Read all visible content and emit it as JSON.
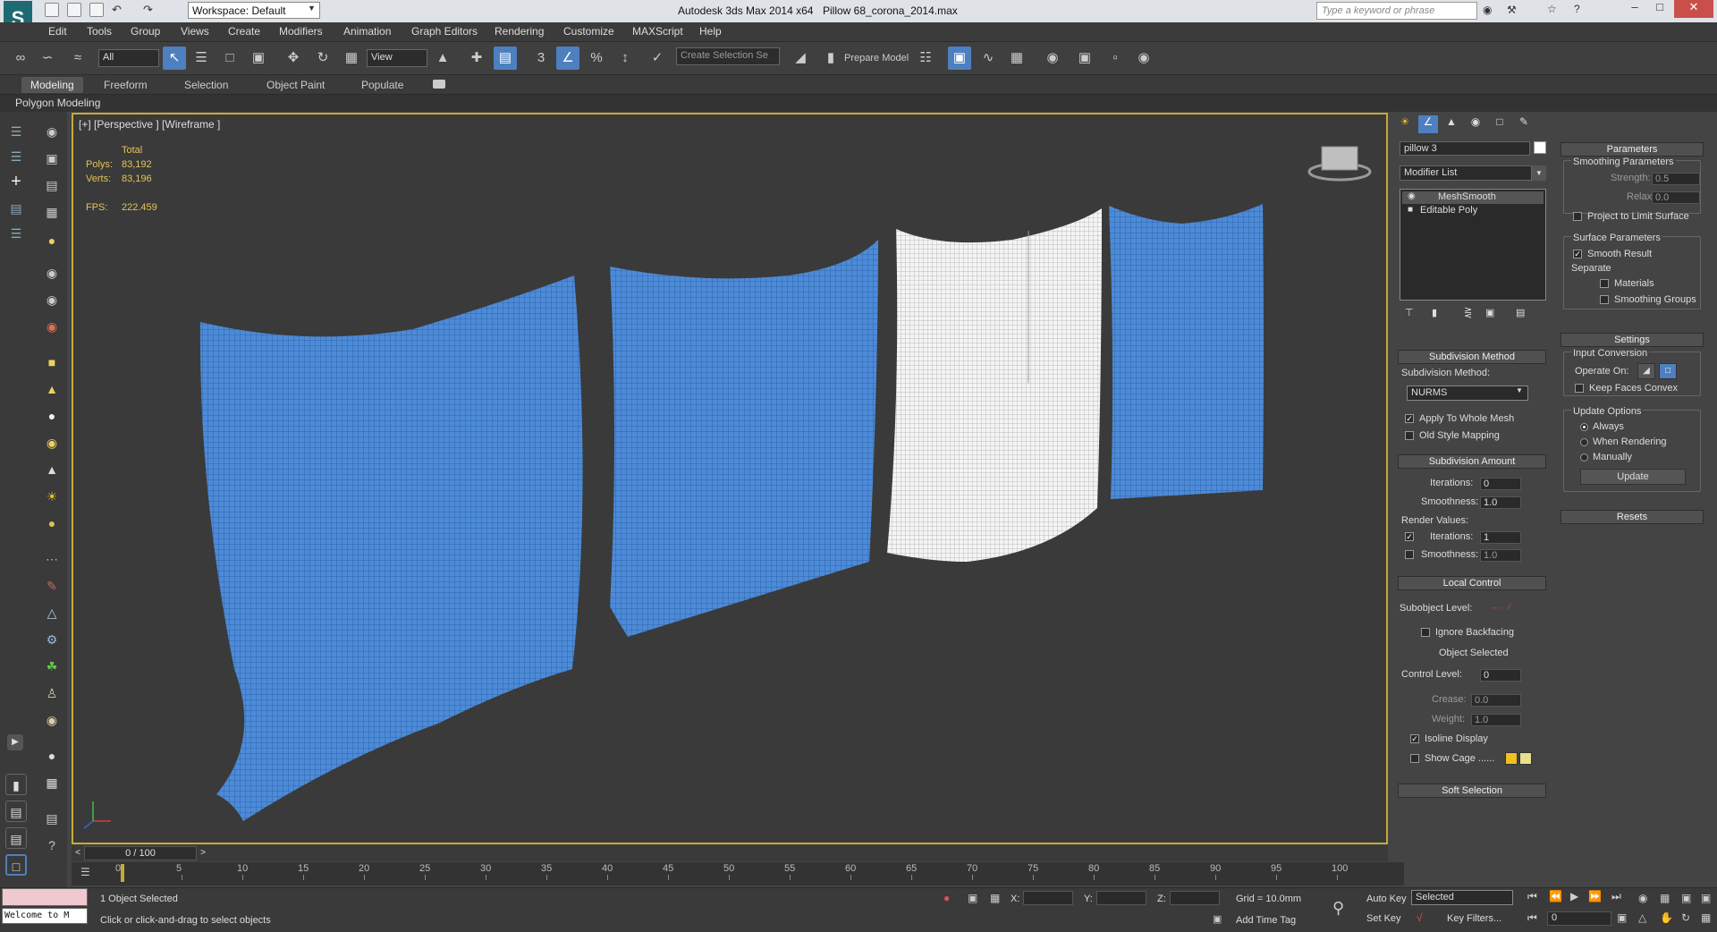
{
  "titlebar": {
    "app_title": "Autodesk 3ds Max  2014 x64",
    "file_title": "Pillow 68_corona_2014.max",
    "workspace": "Workspace: Default",
    "search_placeholder": "Type a keyword or phrase"
  },
  "menu": [
    "Edit",
    "Tools",
    "Group",
    "Views",
    "Create",
    "Modifiers",
    "Animation",
    "Graph Editors",
    "Rendering",
    "Customize",
    "MAXScript",
    "Help"
  ],
  "toolbar": {
    "selection_filter": "All",
    "ref_coord": "View",
    "named_selection": "Create Selection Se",
    "prepare_model": "Prepare Model"
  },
  "ribbon": {
    "tabs": [
      "Modeling",
      "Freeform",
      "Selection",
      "Object Paint",
      "Populate"
    ],
    "active_tab": "Modeling",
    "panel_label": "Polygon Modeling"
  },
  "viewport": {
    "label": "[+] [Perspective ] [Wireframe ]",
    "stats": {
      "total_label": "Total",
      "polys_label": "Polys:",
      "polys_value": "83,192",
      "verts_label": "Verts:",
      "verts_value": "83,196",
      "fps_label": "FPS:",
      "fps_value": "222.459"
    },
    "axis": {
      "x": "x",
      "y": "y",
      "z": "z"
    }
  },
  "command_panel": {
    "object_name": "pillow 3",
    "modifier_list": "Modifier List",
    "stack": [
      "MeshSmooth",
      "Editable Poly"
    ],
    "subdivision_method": {
      "title": "Subdivision Method",
      "method_label": "Subdivision Method:",
      "method_value": "NURMS",
      "apply_whole_mesh": "Apply To Whole Mesh",
      "old_style_mapping": "Old Style Mapping"
    },
    "subdivision_amount": {
      "title": "Subdivision Amount",
      "iterations_label": "Iterations:",
      "iterations_value": "0",
      "smoothness_label": "Smoothness:",
      "smoothness_value": "1.0",
      "render_values_label": "Render Values:",
      "render_iterations_label": "Iterations:",
      "render_iterations_value": "1",
      "render_smoothness_label": "Smoothness:",
      "render_smoothness_value": "1.0"
    },
    "local_control": {
      "title": "Local Control",
      "subobject_label": "Subobject Level:",
      "ignore_backfacing": "Ignore Backfacing",
      "object_selected": "Object Selected",
      "control_level_label": "Control Level:",
      "control_level_value": "0",
      "crease_label": "Crease:",
      "crease_value": "0.0",
      "weight_label": "Weight:",
      "weight_value": "1.0",
      "isoline_display": "Isoline Display",
      "show_cage": "Show Cage ......",
      "cage_color_1": "#f0c020",
      "cage_color_2": "#e8e08a"
    },
    "soft_selection": "Soft Selection",
    "parameters": {
      "title": "Parameters",
      "smoothing_params": "Smoothing Parameters",
      "strength_label": "Strength:",
      "strength_value": "0.5",
      "relax_label": "Relax:",
      "relax_value": "0.0",
      "project_limit": "Project to Limit Surface",
      "surface_params": "Surface Parameters",
      "smooth_result": "Smooth Result",
      "separate": "Separate",
      "materials": "Materials",
      "smoothing_groups": "Smoothing Groups"
    },
    "settings": {
      "title": "Settings",
      "input_conversion": "Input Conversion",
      "operate_on": "Operate On:",
      "keep_faces_convex": "Keep Faces Convex",
      "update_options": "Update Options",
      "always": "Always",
      "when_rendering": "When Rendering",
      "manually": "Manually",
      "update_button": "Update"
    },
    "resets": "Resets"
  },
  "timeline": {
    "frame_counter": "0 / 100",
    "ticks": [
      "0",
      "5",
      "10",
      "15",
      "20",
      "25",
      "30",
      "35",
      "40",
      "45",
      "50",
      "55",
      "60",
      "65",
      "70",
      "75",
      "80",
      "85",
      "90",
      "95",
      "100"
    ]
  },
  "status": {
    "maxscript": "Welcome to M",
    "selection_status": "1 Object Selected",
    "prompt": "Click or click-and-drag to select objects",
    "x_label": "X:",
    "y_label": "Y:",
    "z_label": "Z:",
    "grid": "Grid = 10.0mm",
    "add_time_tag": "Add Time Tag",
    "auto_key": "Auto Key",
    "set_key": "Set Key",
    "key_mode": "Selected",
    "key_filters": "Key Filters...",
    "current_frame": "0"
  }
}
